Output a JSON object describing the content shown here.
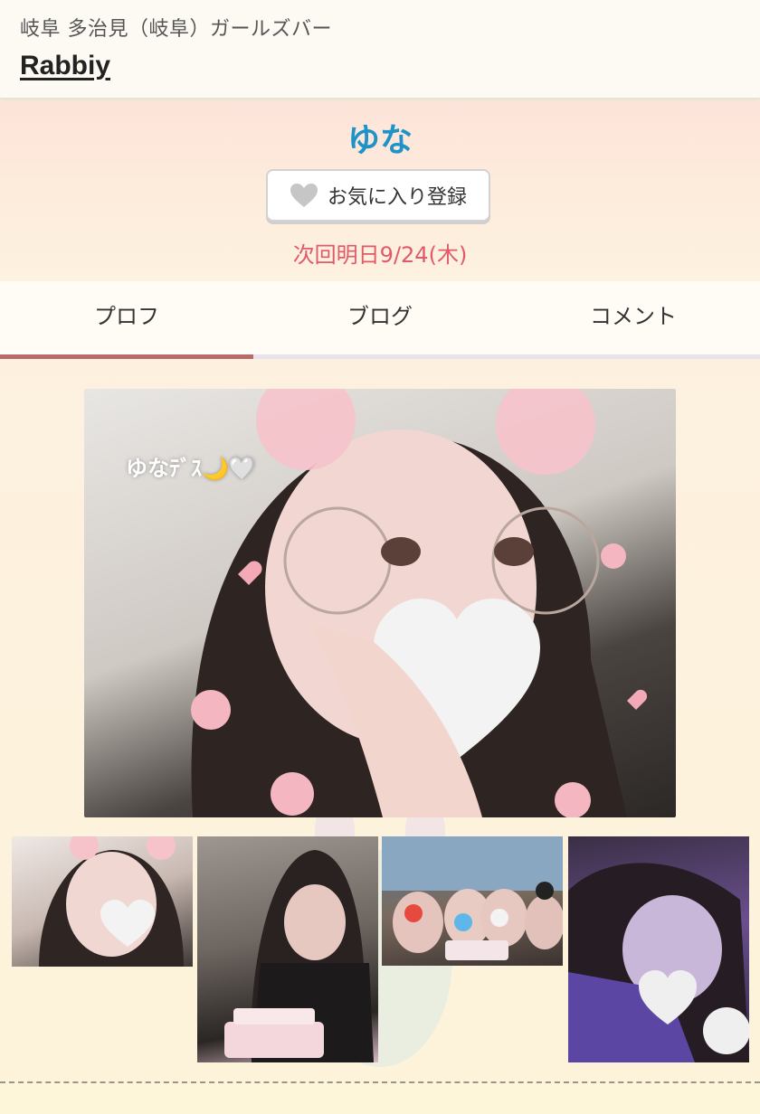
{
  "header": {
    "subtitle": "岐阜 多治見（岐阜）ガールズバー",
    "title": "Rabbiy"
  },
  "profile": {
    "name": "ゆな",
    "favorite_button_label": "お気に入り登録",
    "next_shift": "次回明日9/24(木)"
  },
  "tabs": [
    {
      "label": "プロフ",
      "active": true
    },
    {
      "label": "ブログ",
      "active": false
    },
    {
      "label": "コメント",
      "active": false
    }
  ],
  "main_photo": {
    "caption": "ゆなﾃﾞｽ🌙🤍"
  },
  "colors": {
    "name_color": "#1d93c8",
    "shift_color": "#e05a6a",
    "active_tab_underline": "#b86a6a"
  },
  "icons": {
    "favorite": "heart-icon"
  }
}
